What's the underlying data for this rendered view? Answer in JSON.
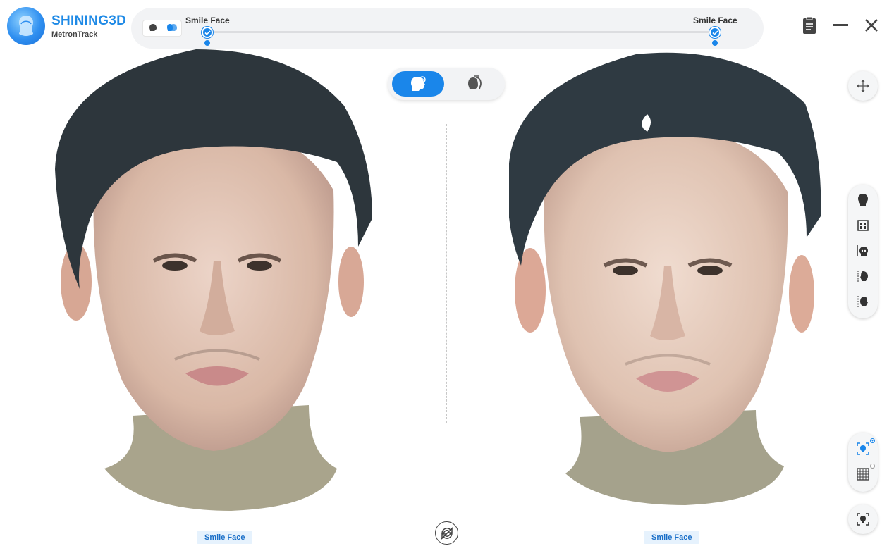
{
  "app": {
    "brand_title": "SHINING3D",
    "brand_subtitle": "MetronTrack"
  },
  "timeline": {
    "marker_left_label": "Smile Face",
    "marker_right_label": "Smile Face"
  },
  "viewports": {
    "left_label": "Smile Face",
    "right_label": "Smile Face"
  },
  "colors": {
    "accent": "#1a86ea",
    "label_bg": "#e6f2fd"
  },
  "icons": {
    "window": [
      "clipboard-icon",
      "minimize-icon",
      "close-icon"
    ],
    "toolbar": [
      "pan-icon",
      "head-front-icon",
      "bite-icon",
      "skull-icon",
      "profile-left-icon",
      "profile-right-icon",
      "face-scan-icon",
      "grid-icon",
      "focus-face-icon"
    ]
  }
}
